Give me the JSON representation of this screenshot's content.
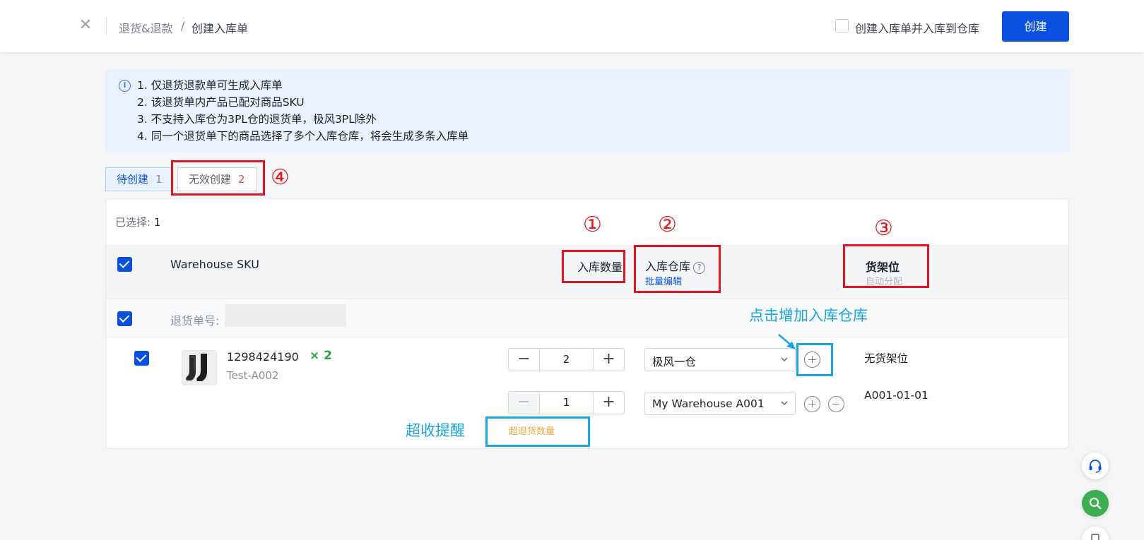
{
  "header": {
    "breadcrumb_parent": "退货&退款",
    "breadcrumb_sep": "/",
    "breadcrumb_current": "创建入库单",
    "option_label": "创建入库单并入库到仓库",
    "create_label": "创建"
  },
  "notice": {
    "lines": [
      "1. 仅退货退款单可生成入库单",
      "2. 该退货单内产品已配对商品SKU",
      "3. 不支持入库仓为3PL仓的退货单，极风3PL除外",
      "4. 同一个退货单下的商品选择了多个入库仓库，将会生成多条入库单"
    ]
  },
  "tabs": [
    {
      "label": "待创建",
      "count": "1"
    },
    {
      "label": "无效创建",
      "count": "2"
    }
  ],
  "table": {
    "selected_label": "已选择:",
    "selected_count": "1",
    "col_sku": "Warehouse SKU",
    "col_qty": "入库数量",
    "col_warehouse": "入库仓库",
    "col_warehouse_sub": "批量编辑",
    "col_shelf": "货架位",
    "col_shelf_sub": "自动分配",
    "group_label": "退货单号:",
    "item": {
      "code": "1298424190",
      "multiplier": "× 2",
      "name": "Test-A002",
      "allocations": [
        {
          "qty": "2",
          "warehouse": "极风一仓",
          "shelf": "无货架位"
        },
        {
          "qty": "1",
          "warehouse": "My Warehouse A001",
          "shelf": "A001-01-01"
        }
      ],
      "over_warning": "超退货数量"
    }
  },
  "annotations": {
    "n1": "①",
    "n2": "②",
    "n3": "③",
    "n4": "④",
    "add_warehouse_note": "点击增加入库仓库",
    "over_receive_note": "超收提醒"
  },
  "colors": {
    "primary": "#0a50e0",
    "annotation_red": "#e3161f",
    "annotation_blue": "#19a4e8",
    "warning": "#f0a640",
    "success": "#27a441"
  }
}
